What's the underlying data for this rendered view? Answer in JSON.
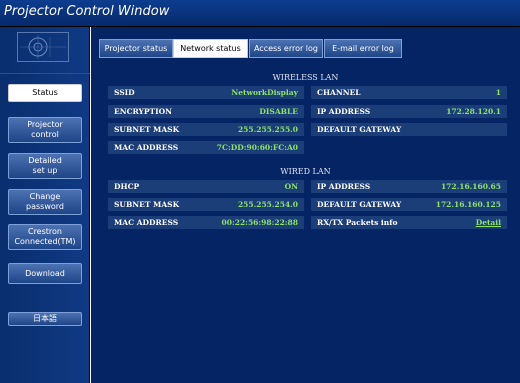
{
  "window": {
    "title": "Projector Control Window"
  },
  "sidebar": {
    "items": [
      {
        "label": "Status",
        "active": true
      },
      {
        "label": "Projector\ncontrol"
      },
      {
        "label": "Detailed\nset up"
      },
      {
        "label": "Change\npassword"
      },
      {
        "label": "Crestron\nConnected(TM)"
      },
      {
        "label": "Download"
      },
      {
        "label": "日本語"
      }
    ]
  },
  "tabs": [
    {
      "label": "Projector status"
    },
    {
      "label": "Network status",
      "active": true
    },
    {
      "label": "Access error log"
    },
    {
      "label": "E-mail error log"
    }
  ],
  "wireless": {
    "title": "WIRELESS LAN",
    "ssid_label": "SSID",
    "ssid": "NetworkDisplay",
    "channel_label": "CHANNEL",
    "channel": "1",
    "encryption_label": "ENCRYPTION",
    "encryption": "DISABLE",
    "ip_label": "IP ADDRESS",
    "ip": "172.28.120.1",
    "subnet_label": "SUBNET MASK",
    "subnet": "255.255.255.0",
    "gateway_label": "DEFAULT GATEWAY",
    "gateway": "",
    "mac_label": "MAC ADDRESS",
    "mac": "7C:DD:90:60:FC:A0"
  },
  "wired": {
    "title": "WIRED LAN",
    "dhcp_label": "DHCP",
    "dhcp": "ON",
    "ip_label": "IP ADDRESS",
    "ip": "172.16.160.65",
    "subnet_label": "SUBNET MASK",
    "subnet": "255.255.254.0",
    "gateway_label": "DEFAULT GATEWAY",
    "gateway": "172.16.160.125",
    "mac_label": "MAC ADDRESS",
    "mac": "00:22:56:98:22:88",
    "packets_label": "RX/TX Packets info",
    "packets_link": "Detail"
  },
  "colors": {
    "title_bar": "#0d3d8f",
    "panel_bg": "#052463",
    "value_text": "#8fe36a",
    "label_cell": "#1b3d78"
  }
}
